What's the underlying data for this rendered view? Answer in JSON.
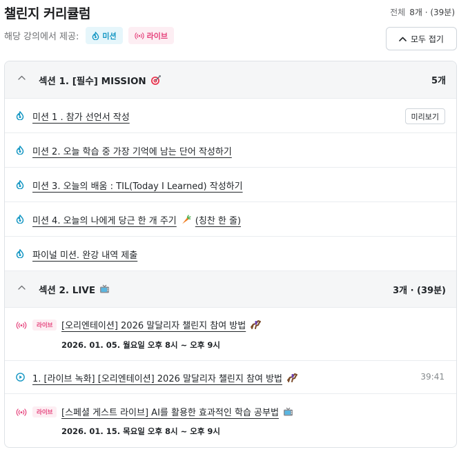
{
  "header": {
    "title": "챌린지 커리큘럼",
    "total_label": "전체",
    "total_value": "8개 · (39분)",
    "provided_label": "해당 강의에서 제공:",
    "tag_mission": "미션",
    "tag_live": "라이브",
    "collapse_all": "모두 접기"
  },
  "sections": [
    {
      "title": "섹션 1. [필수] MISSION",
      "count": "5개",
      "items": [
        {
          "label": "미션 1 . 참가 선언서 작성",
          "icon": "mission-icon",
          "preview": "미리보기"
        },
        {
          "label": "미션 2. 오늘 학습 중 가장 기억에 남는 단어 작성하기",
          "icon": "mission-icon"
        },
        {
          "label": "미션 3. 오늘의 배움 : TIL(Today I Learned) 작성하기",
          "icon": "mission-icon"
        },
        {
          "label": "미션 4. 오늘의 나에게 당근 한 개 주기",
          "label_suffix": "(칭찬 한 줄)",
          "icon": "mission-icon",
          "emoji": "carrot-icon"
        },
        {
          "label": "파이널 미션. 완강 내역 제출",
          "icon": "mission-icon"
        }
      ]
    },
    {
      "title": "섹션 2. LIVE",
      "count": "3개 · (39분)",
      "items": [
        {
          "label": "[오리엔테이션] 2026 말달리자 챌린지 참여 방법",
          "pill": "라이브",
          "schedule": "2026. 01. 05. 월요일 오후 8시 ~ 오후 9시",
          "icon": "live-icon",
          "emoji": "horse-racing-icon"
        },
        {
          "label": "1. [라이브 녹화] [오리엔테이션] 2026 말달리자 챌린지 참여 방법",
          "time": "39:41",
          "icon": "play-circle-icon",
          "emoji": "horse-racing-icon"
        },
        {
          "label": "[스페셜 게스트 라이브] AI를 활용한 효과적인 학습 공부법",
          "pill": "라이브",
          "schedule": "2026. 01. 15. 목요일 오후 8시 ~ 오후 9시",
          "icon": "live-icon",
          "emoji": "tv-icon"
        }
      ]
    }
  ],
  "colors": {
    "mission_blue": "#1396c3",
    "live_pink": "#e5407a",
    "section_bg": "#f5f6f7",
    "border": "#dee2e6"
  }
}
